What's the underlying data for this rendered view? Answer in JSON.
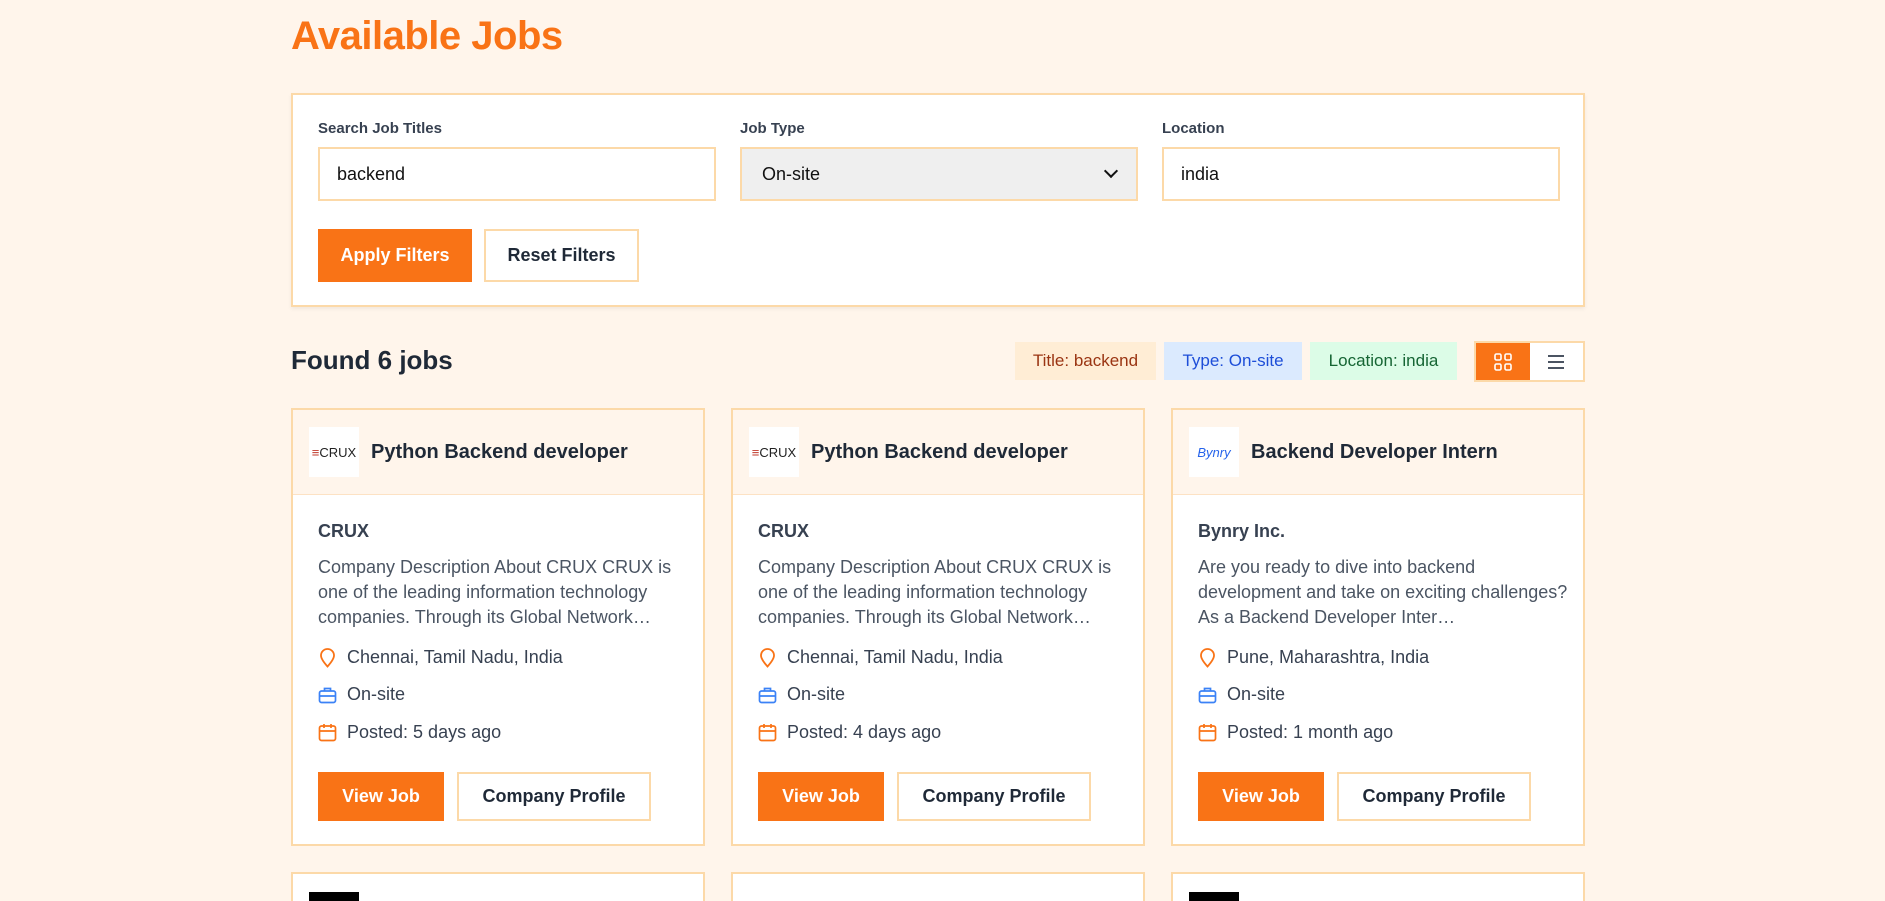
{
  "page": {
    "title": "Available Jobs"
  },
  "filters": {
    "search_label": "Search Job Titles",
    "search_value": "backend",
    "type_label": "Job Type",
    "type_value": "On-site",
    "location_label": "Location",
    "location_value": "india",
    "apply_label": "Apply Filters",
    "reset_label": "Reset Filters"
  },
  "results": {
    "found_text": "Found 6 jobs",
    "chips": {
      "title": "Title: backend",
      "type": "Type: On-site",
      "location": "Location: india"
    },
    "view_modes": [
      "grid-icon",
      "list-icon"
    ],
    "active_view": "grid"
  },
  "jobs": [
    {
      "logo_text": "CRUX",
      "title": "Python Backend developer",
      "company": "CRUX",
      "description": "Company Description About CRUX CRUX is one of the leading information technology companies. Through its Global Network…",
      "location": "Chennai, Tamil Nadu, India",
      "type": "On-site",
      "posted": "Posted: 5 days ago",
      "view_label": "View Job",
      "profile_label": "Company Profile"
    },
    {
      "logo_text": "CRUX",
      "title": "Python Backend developer",
      "company": "CRUX",
      "description": "Company Description About CRUX CRUX is one of the leading information technology companies. Through its Global Network…",
      "location": "Chennai, Tamil Nadu, India",
      "type": "On-site",
      "posted": "Posted: 4 days ago",
      "view_label": "View Job",
      "profile_label": "Company Profile"
    },
    {
      "logo_text": "Bynry",
      "title": "Backend Developer Intern",
      "company": "Bynry Inc.",
      "description": "Are you ready to dive into backend development and take on exciting challenges? As a Backend Developer Inter…",
      "location": "Pune, Maharashtra, India",
      "type": "On-site",
      "posted": "Posted: 1 month ago",
      "view_label": "View Job",
      "profile_label": "Company Profile"
    }
  ],
  "colors": {
    "accent": "#f97316",
    "background": "#fff5eb",
    "border": "#fcd9a8"
  }
}
